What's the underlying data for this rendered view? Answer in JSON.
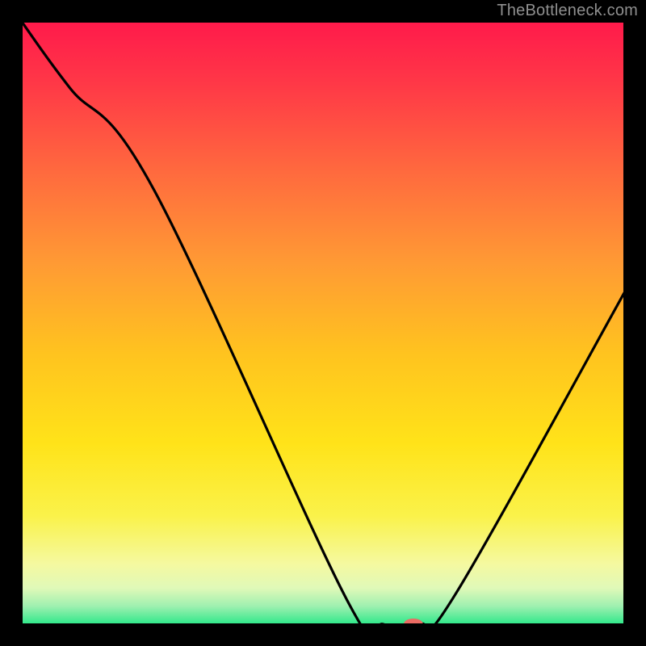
{
  "watermark": "TheBottleneck.com",
  "chart_data": {
    "type": "line",
    "title": "",
    "xlabel": "",
    "ylabel": "",
    "xlim": [
      0,
      100
    ],
    "ylim": [
      0,
      100
    ],
    "x": [
      0,
      8,
      22,
      54,
      60,
      66,
      72,
      100
    ],
    "values": [
      100,
      89,
      72,
      4,
      0,
      0,
      5,
      55
    ],
    "bottleneck_x": 65,
    "bottleneck_y": 0,
    "gradient_stops": [
      {
        "offset": 0.0,
        "color": "#ff1a4b"
      },
      {
        "offset": 0.1,
        "color": "#ff3747"
      },
      {
        "offset": 0.25,
        "color": "#ff6a3e"
      },
      {
        "offset": 0.4,
        "color": "#ff9a34"
      },
      {
        "offset": 0.55,
        "color": "#ffc31f"
      },
      {
        "offset": 0.7,
        "color": "#ffe319"
      },
      {
        "offset": 0.82,
        "color": "#faf24a"
      },
      {
        "offset": 0.9,
        "color": "#f5f9a0"
      },
      {
        "offset": 0.94,
        "color": "#e0f9b8"
      },
      {
        "offset": 0.97,
        "color": "#9ff0b0"
      },
      {
        "offset": 1.0,
        "color": "#2fe88a"
      }
    ],
    "marker": {
      "color": "#ea6b63",
      "rx": 12,
      "ry": 7
    }
  }
}
